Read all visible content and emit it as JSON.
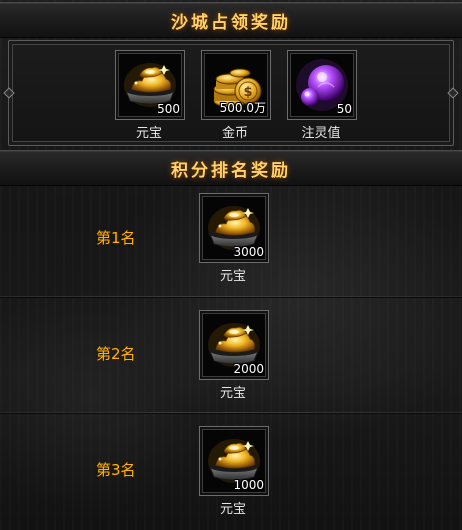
{
  "siege_reward": {
    "title": "沙城占领奖励",
    "items": [
      {
        "name": "元宝",
        "count": "500",
        "icon": "gold-ingot-icon"
      },
      {
        "name": "金币",
        "count": "500.0万",
        "icon": "gold-coins-icon"
      },
      {
        "name": "注灵值",
        "count": "50",
        "icon": "purple-orb-icon"
      }
    ]
  },
  "rank_reward": {
    "title": "积分排名奖励",
    "ranks": [
      {
        "label": "第1名",
        "item_name": "元宝",
        "count": "3000",
        "icon": "gold-ingot-icon"
      },
      {
        "label": "第2名",
        "item_name": "元宝",
        "count": "2000",
        "icon": "gold-ingot-icon"
      },
      {
        "label": "第3名",
        "item_name": "元宝",
        "count": "1000",
        "icon": "gold-ingot-icon"
      }
    ]
  },
  "colors": {
    "title_gold": "#ffd36a",
    "rank_orange": "#ffb300",
    "item_border": "#6c6c6c"
  }
}
